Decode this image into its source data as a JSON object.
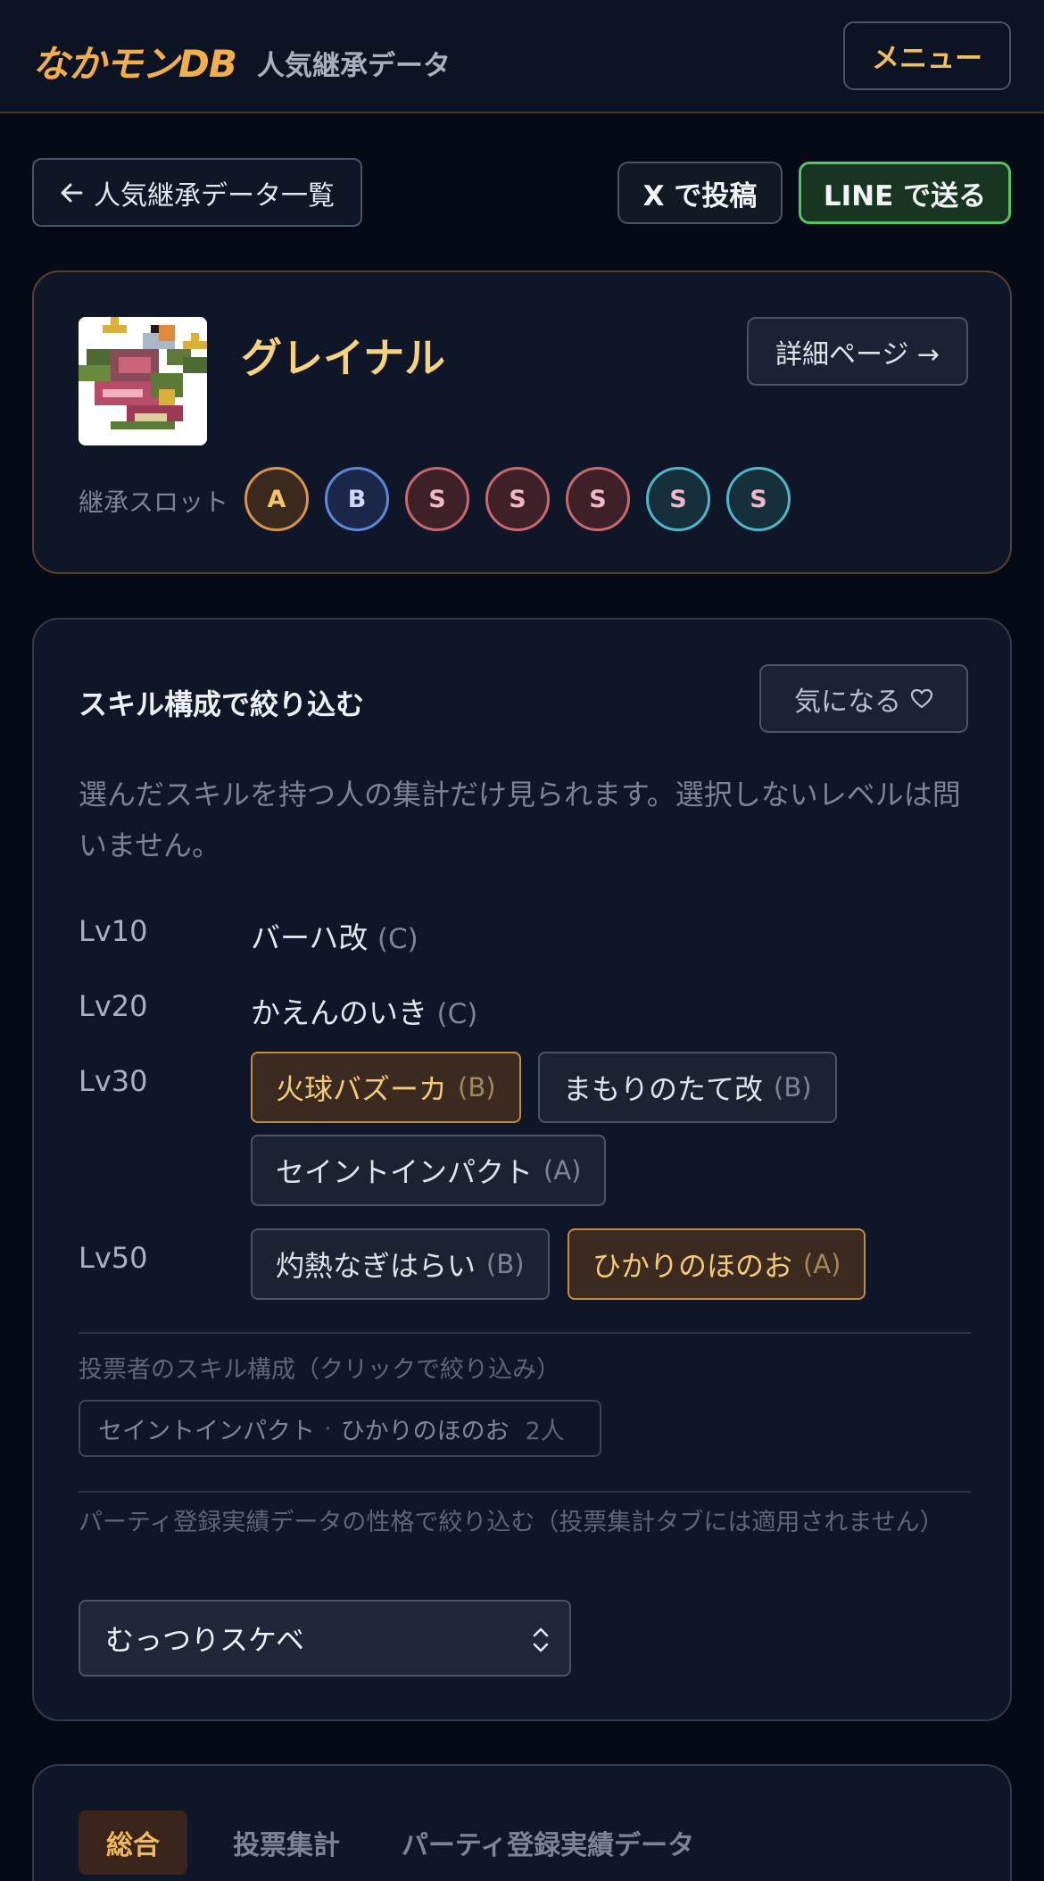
{
  "header": {
    "brand": "なかモンDB",
    "subtitle": "人気継承データ",
    "menu_label": "メニュー"
  },
  "actions": {
    "back_label": "人気継承データ一覧",
    "x_label": "X で投稿",
    "line_label": "LINE で送る"
  },
  "monster": {
    "name": "グレイナル",
    "detail_label": "詳細ページ →",
    "slot_label": "継承スロット",
    "slots": [
      "A",
      "B",
      "S",
      "S",
      "S",
      "S",
      "S"
    ]
  },
  "filter": {
    "title": "スキル構成で絞り込む",
    "fav_label": "気になる",
    "description": "選んだスキルを持つ人の集計だけ見られます。選択しないレベルは問いません。",
    "levels": [
      {
        "level": "Lv10",
        "skills": [
          {
            "name": "バーハ改",
            "grade": "(C)"
          }
        ]
      },
      {
        "level": "Lv20",
        "skills": [
          {
            "name": "かえんのいき",
            "grade": "(C)"
          }
        ]
      },
      {
        "level": "Lv30",
        "skills": [
          {
            "name": "火球バズーカ",
            "grade": "(B)",
            "selected": true
          },
          {
            "name": "まもりのたて改",
            "grade": "(B)",
            "selected": false
          },
          {
            "name": "セイントインパクト",
            "grade": "(A)",
            "selected": false
          }
        ]
      },
      {
        "level": "Lv50",
        "skills": [
          {
            "name": "灼熱なぎはらい",
            "grade": "(B)",
            "selected": false
          },
          {
            "name": "ひかりのほのお",
            "grade": "(A)",
            "selected": true
          }
        ]
      }
    ],
    "voter_label": "投票者のスキル構成（クリックで絞り込み）",
    "voter_combo": {
      "skill1": "セイントインパクト",
      "sep": "·",
      "skill2": "ひかりのほのお",
      "count": "2人"
    },
    "nature_label": "パーティ登録実績データの性格で絞り込む（投票集計タブには適用されません）",
    "nature_value": "むっつりスケベ"
  },
  "tabs": [
    "総合",
    "投票集計",
    "パーティ登録実績データ"
  ],
  "colors": {
    "background": "#060a17",
    "accent": "#f2ae4a",
    "line_green": "#56c266"
  }
}
